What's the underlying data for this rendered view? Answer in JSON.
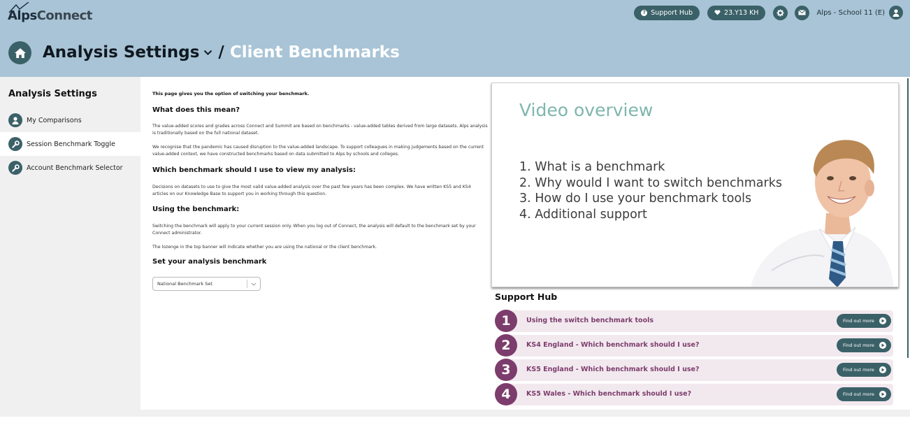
{
  "header": {
    "logo_part1": "Alps",
    "logo_part2": "Connect",
    "support_hub_label": "Support Hub",
    "dataset_label": "23.Y13 KH",
    "school_name": "Alps - School 11 (E)",
    "title": "Analysis Settings",
    "separator": "/",
    "subtitle": "Client Benchmarks"
  },
  "sidebar": {
    "title": "Analysis Settings",
    "items": [
      {
        "label": "My Comparisons",
        "icon": "user-icon"
      },
      {
        "label": "Session Benchmark Toggle",
        "icon": "wrench-icon"
      },
      {
        "label": "Account Benchmark Selector",
        "icon": "wrench-icon"
      }
    ]
  },
  "main": {
    "intro": "This page gives you the option of switching your benchmark.",
    "sections": [
      {
        "heading": "What does this mean?",
        "paragraphs": [
          "The value-added scores and grades across Connect and Summit are based on benchmarks - value-added tables derived from large datasets. Alps analysis is traditionally based on the full national dataset.",
          "We recognise that the pandemic has caused disruption to the value-added landscape. To support colleagues in making judgements based on the current value-added context, we have constructed benchmarks based on data submitted to Alps by schools and colleges."
        ]
      },
      {
        "heading": "Which benchmark should I use to view my analysis:",
        "paragraphs": [
          "Decisions on datasets to use to give the most valid value-added analysis over the past few years has been complex. We have written KS5 and KS4 articles on our Knowledge Base to support you in working through this question."
        ]
      },
      {
        "heading": "Using the benchmark:",
        "paragraphs": [
          "Switching the benchmark will apply to your current session only. When you log out of Connect, the analysis will default to the benchmark set by your Connect administrator.",
          "The lozenge in the top banner will indicate whether you are using the national or the client benchmark."
        ]
      },
      {
        "heading": "Set your analysis benchmark",
        "paragraphs": []
      }
    ],
    "benchmark_select_value": "National Benchmark Set"
  },
  "video": {
    "title": "Video overview",
    "items": [
      "1.  What is a benchmark",
      "2.  Why would I want to switch benchmarks",
      "3.  How do I use your benchmark tools",
      "4.  Additional support"
    ]
  },
  "support_hub": {
    "title": "Support Hub",
    "button_label": "Find out more",
    "items": [
      {
        "number": "1",
        "label": "Using the switch benchmark tools"
      },
      {
        "number": "2",
        "label": "KS4 England - Which benchmark should I use?"
      },
      {
        "number": "3",
        "label": "KS5 England - Which benchmark should I use?"
      },
      {
        "number": "4",
        "label": "KS5 Wales - Which benchmark should I use?"
      }
    ]
  },
  "colors": {
    "header_bg": "#a8c4d6",
    "accent_teal": "#3b6168",
    "hub_purple": "#7c3d6c",
    "hub_row_bg": "#f2e9ef",
    "video_title": "#7fb6ad"
  }
}
